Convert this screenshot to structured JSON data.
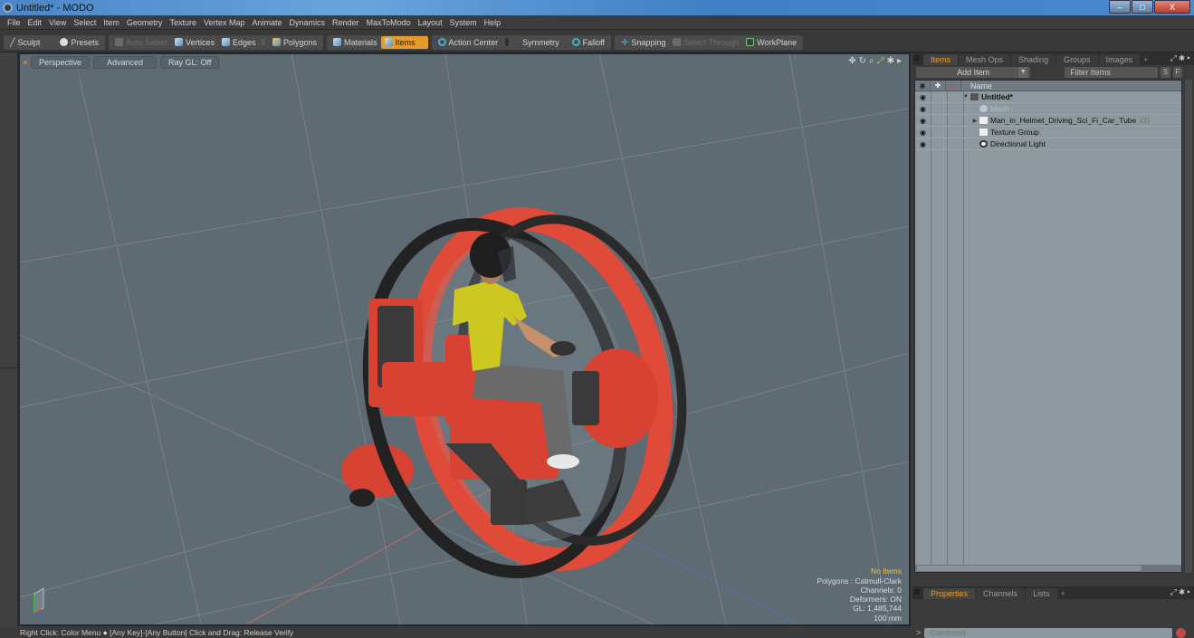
{
  "window": {
    "title": "Untitled* - MODO",
    "controls": {
      "minimize": "–",
      "maximize": "□",
      "close": "X"
    }
  },
  "menubar": [
    "File",
    "Edit",
    "View",
    "Select",
    "Item",
    "Geometry",
    "Texture",
    "Vertex Map",
    "Animate",
    "Dynamics",
    "Render",
    "MaxToModo",
    "Layout",
    "System",
    "Help"
  ],
  "toolbar": {
    "sculpt": "Sculpt",
    "presets": "Presets",
    "auto_select": "Auto Select",
    "vertices": "Vertices",
    "edges": "Edges",
    "edges_badge": "2",
    "polygons": "Polygons",
    "materials": "Materials",
    "items": "Items",
    "action_center": "Action Center",
    "symmetry": "Symmetry",
    "falloff": "Falloff",
    "snapping": "Snapping",
    "select_through": "Select Through",
    "workplane": "WorkPlane",
    "active_mode": "Items",
    "accent_color": "#e59a2e"
  },
  "viewport": {
    "view_mode": "Perspective",
    "shading": "Advanced",
    "raygl": "Ray GL: Off",
    "icons": [
      "move-view-icon",
      "rotate-view-icon",
      "zoom-view-icon",
      "fit-view-icon",
      "gear-icon",
      "more-arrow-icon"
    ],
    "stats": {
      "selection": "No Items",
      "polygons": "Polygons : Catmull-Clark",
      "channels": "Channels: 0",
      "deformers": "Deformers: ON",
      "gl": "GL: 1,485,744",
      "unit": "100 mm"
    }
  },
  "statusbar": {
    "text1": "Right Click: Color Menu",
    "text2": "[Any Key]-[Any Button] Click and Drag: Release Verify"
  },
  "items_panel": {
    "tabs": [
      "Items",
      "Mesh Ops",
      "Shading",
      "Groups",
      "Images",
      "+"
    ],
    "active_tab": "Items",
    "add_item": "Add Item",
    "filter_placeholder": "Filter Items",
    "s_button": "S",
    "f_button": "F",
    "column_name": "Name",
    "tree": [
      {
        "label": "Untitled*",
        "level": 0,
        "expanded": true,
        "bold": true,
        "icon": "scene-icon"
      },
      {
        "label": "Mesh",
        "level": 1,
        "dim": true,
        "icon": "mesh-icon"
      },
      {
        "label": "Man_in_Helmet_Driving_Sci_Fi_Car_Tube",
        "level": 1,
        "collapsed": true,
        "count": "(3)",
        "icon": "group-locator-icon"
      },
      {
        "label": "Texture Group",
        "level": 1,
        "icon": "group-locator-icon"
      },
      {
        "label": "Directional Light",
        "level": 1,
        "icon": "light-icon"
      }
    ]
  },
  "props_panel": {
    "tabs": [
      "Properties",
      "Channels",
      "Lists",
      "+"
    ],
    "active_tab": "Properties"
  },
  "command": {
    "prompt": ">",
    "placeholder": "Command"
  }
}
